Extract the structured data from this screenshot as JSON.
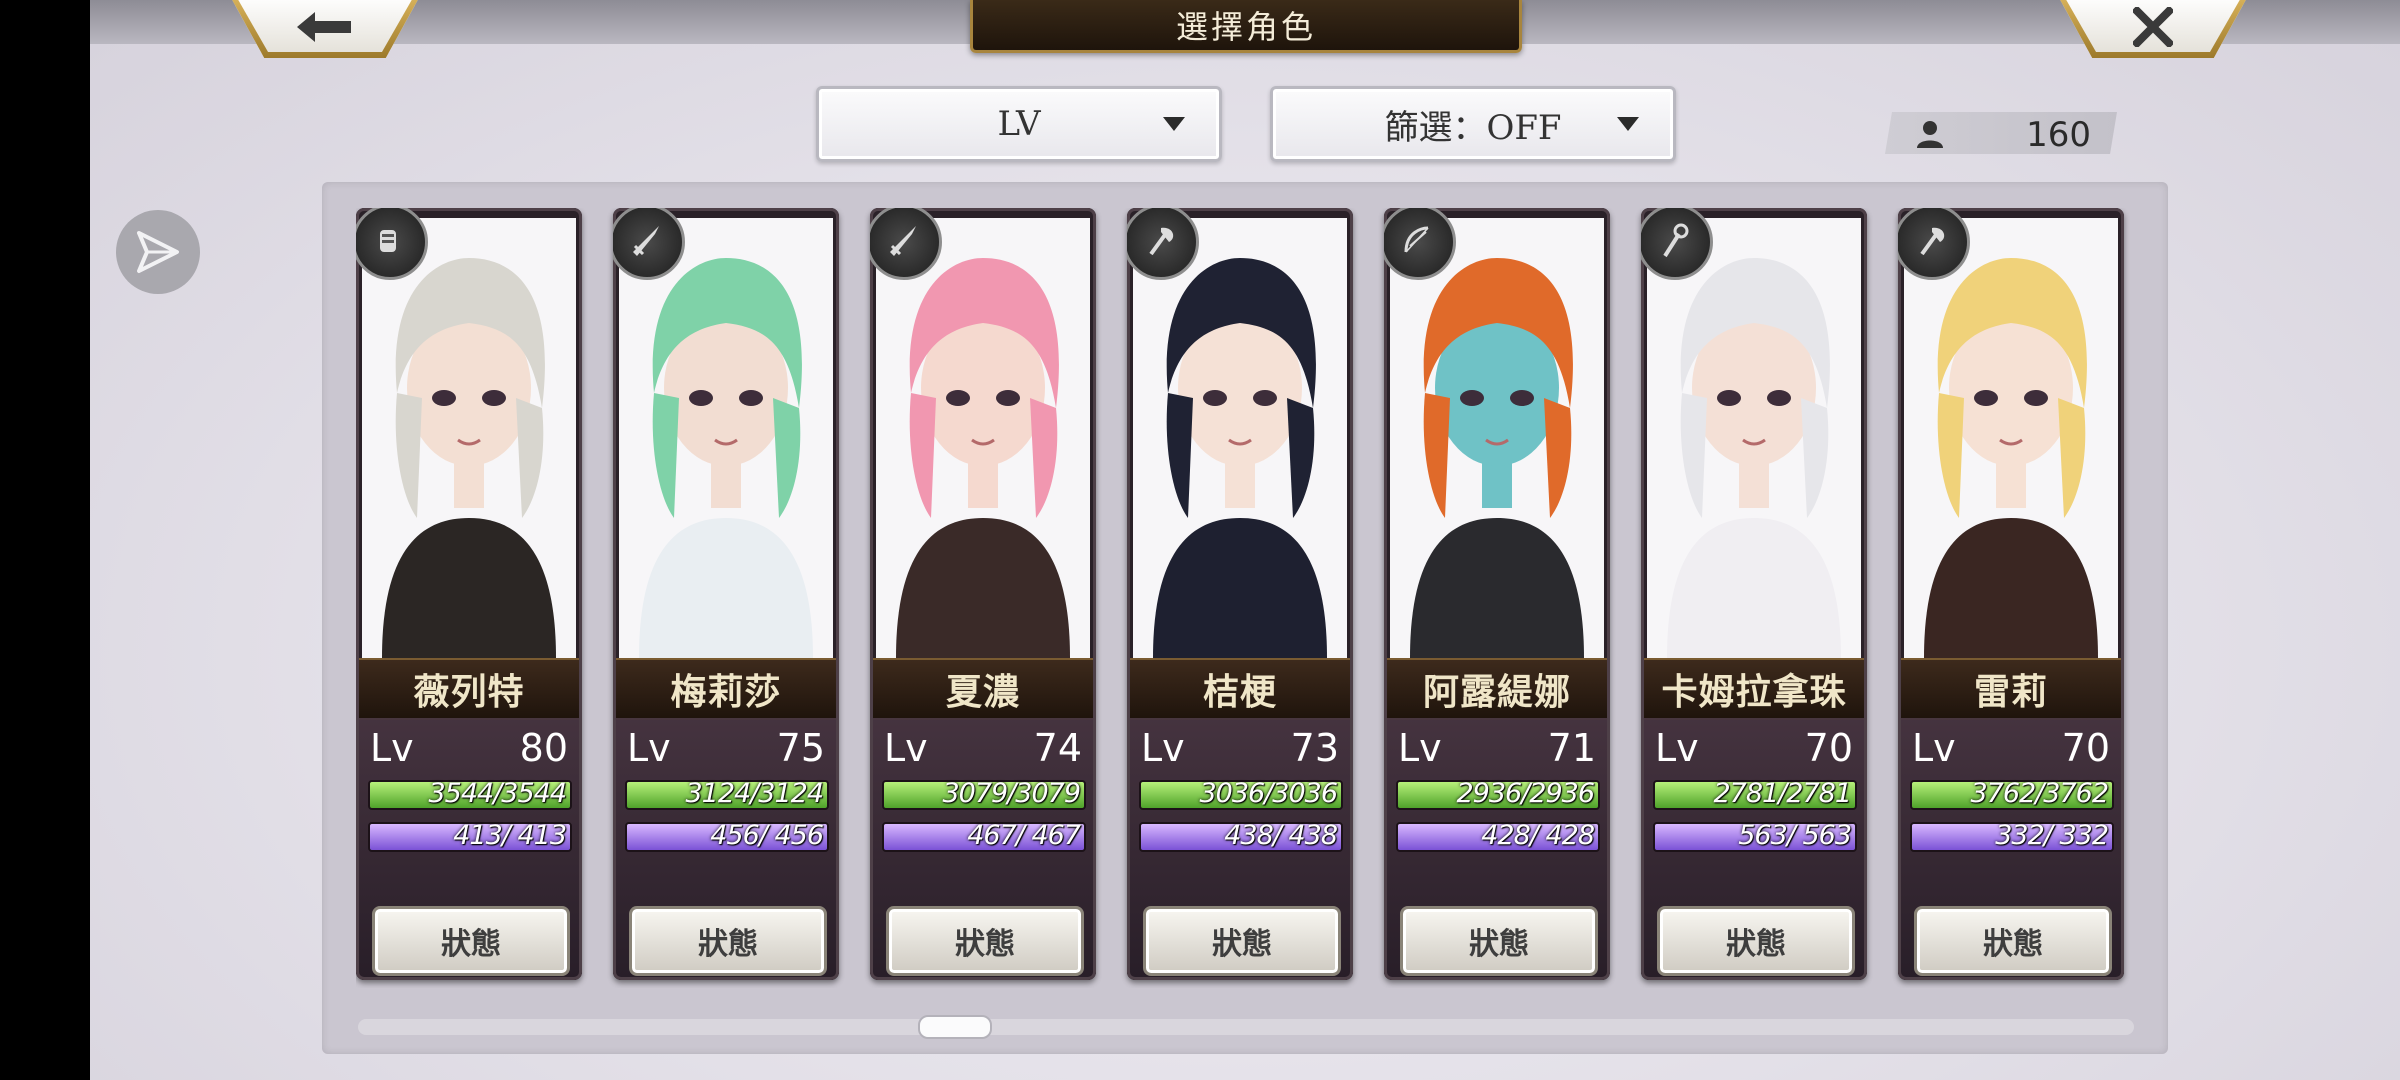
{
  "header": {
    "title": "選擇角色",
    "back_icon": "left-arrow-icon",
    "close_icon": "close-x-icon"
  },
  "sort": {
    "selected": "LV"
  },
  "filter": {
    "selected": "篩選：OFF"
  },
  "character_count": "160",
  "status_label": "狀態",
  "colors": {
    "hp_bar": "#4fa22a",
    "mp_bar": "#7b52d6",
    "frame_gold": "#c9a24c"
  },
  "characters": [
    {
      "name": "薇列特",
      "lv_label": "Lv",
      "level": "80",
      "hp": "3544/3544",
      "mp": "413/ 413",
      "weapon_icon": "gauntlet-icon",
      "hair": "#d8d6cf",
      "skin": "#f3dfd3",
      "outfit": "#2b2624"
    },
    {
      "name": "梅莉莎",
      "lv_label": "Lv",
      "level": "75",
      "hp": "3124/3124",
      "mp": "456/ 456",
      "weapon_icon": "sword-icon",
      "hair": "#7fd2a8",
      "skin": "#f2ddd2",
      "outfit": "#e9eef2"
    },
    {
      "name": "夏濃",
      "lv_label": "Lv",
      "level": "74",
      "hp": "3079/3079",
      "mp": "467/ 467",
      "weapon_icon": "sword-icon",
      "hair": "#f197b0",
      "skin": "#f5d9cf",
      "outfit": "#3a2a28"
    },
    {
      "name": "桔梗",
      "lv_label": "Lv",
      "level": "73",
      "hp": "3036/3036",
      "mp": "438/ 438",
      "weapon_icon": "axe-icon",
      "hair": "#1f2233",
      "skin": "#f5e1d6",
      "outfit": "#1e2030"
    },
    {
      "name": "阿露緹娜",
      "lv_label": "Lv",
      "level": "71",
      "hp": "2936/2936",
      "mp": "428/ 428",
      "weapon_icon": "bow-icon",
      "hair": "#e06a2a",
      "skin": "#6fc2c6",
      "outfit": "#2a2a2e"
    },
    {
      "name": "卡姆拉拿珠",
      "lv_label": "Lv",
      "level": "70",
      "hp": "2781/2781",
      "mp": "563/ 563",
      "weapon_icon": "staff-icon",
      "hair": "#e6e6ea",
      "skin": "#f4e0d6",
      "outfit": "#f0eef2"
    },
    {
      "name": "雷莉",
      "lv_label": "Lv",
      "level": "70",
      "hp": "3762/3762",
      "mp": "332/ 332",
      "weapon_icon": "axe-icon",
      "hair": "#f0d27a",
      "skin": "#f6e1d4",
      "outfit": "#3a2622"
    }
  ]
}
